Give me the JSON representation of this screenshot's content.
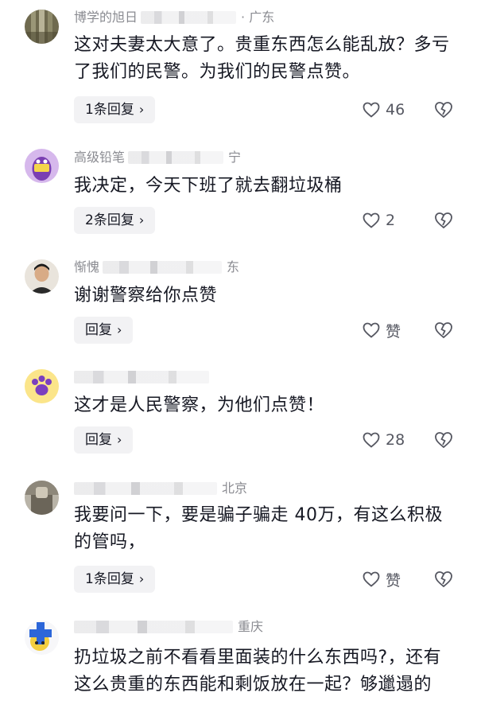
{
  "comments": [
    {
      "username": "博学的旭日",
      "region": "· 广东",
      "text": "这对夫妻太大意了。贵重东西怎么能乱放？多亏了我们的民警。为我们的民警点赞。",
      "reply_label": "1条回复",
      "like_count": "46"
    },
    {
      "username": "高级铅笔",
      "region": "宁",
      "text": "我决定，今天下班了就去翻垃圾桶",
      "reply_label": "2条回复",
      "like_count": "2"
    },
    {
      "username": "惭愧",
      "region": "东",
      "text": "谢谢警察给你点赞",
      "reply_label": "回复",
      "like_count": "赞"
    },
    {
      "username": "",
      "region": "",
      "text": "这才是人民警察，为他们点赞！",
      "reply_label": "回复",
      "like_count": "28"
    },
    {
      "username": "",
      "region": "北京",
      "text": "我要问一下，要是骗子骗走 40万，有这么积极的管吗，",
      "reply_label": "1条回复",
      "like_count": "赞"
    },
    {
      "username": "",
      "region": "重庆",
      "text": "扔垃圾之前不看看里面装的什么东西吗?，还有这么贵重的东西能和剩饭放在一起？够邋遢的",
      "reply_label": "",
      "like_count": ""
    }
  ],
  "icons": {
    "like": "heart-outline-icon",
    "dislike": "broken-heart-icon",
    "reply_chevron": "chevron-right-icon",
    "reply_chevron_glyph": "›"
  },
  "colors": {
    "text": "#161823",
    "meta": "#8a8b91",
    "reply_bg": "#f2f2f4"
  }
}
